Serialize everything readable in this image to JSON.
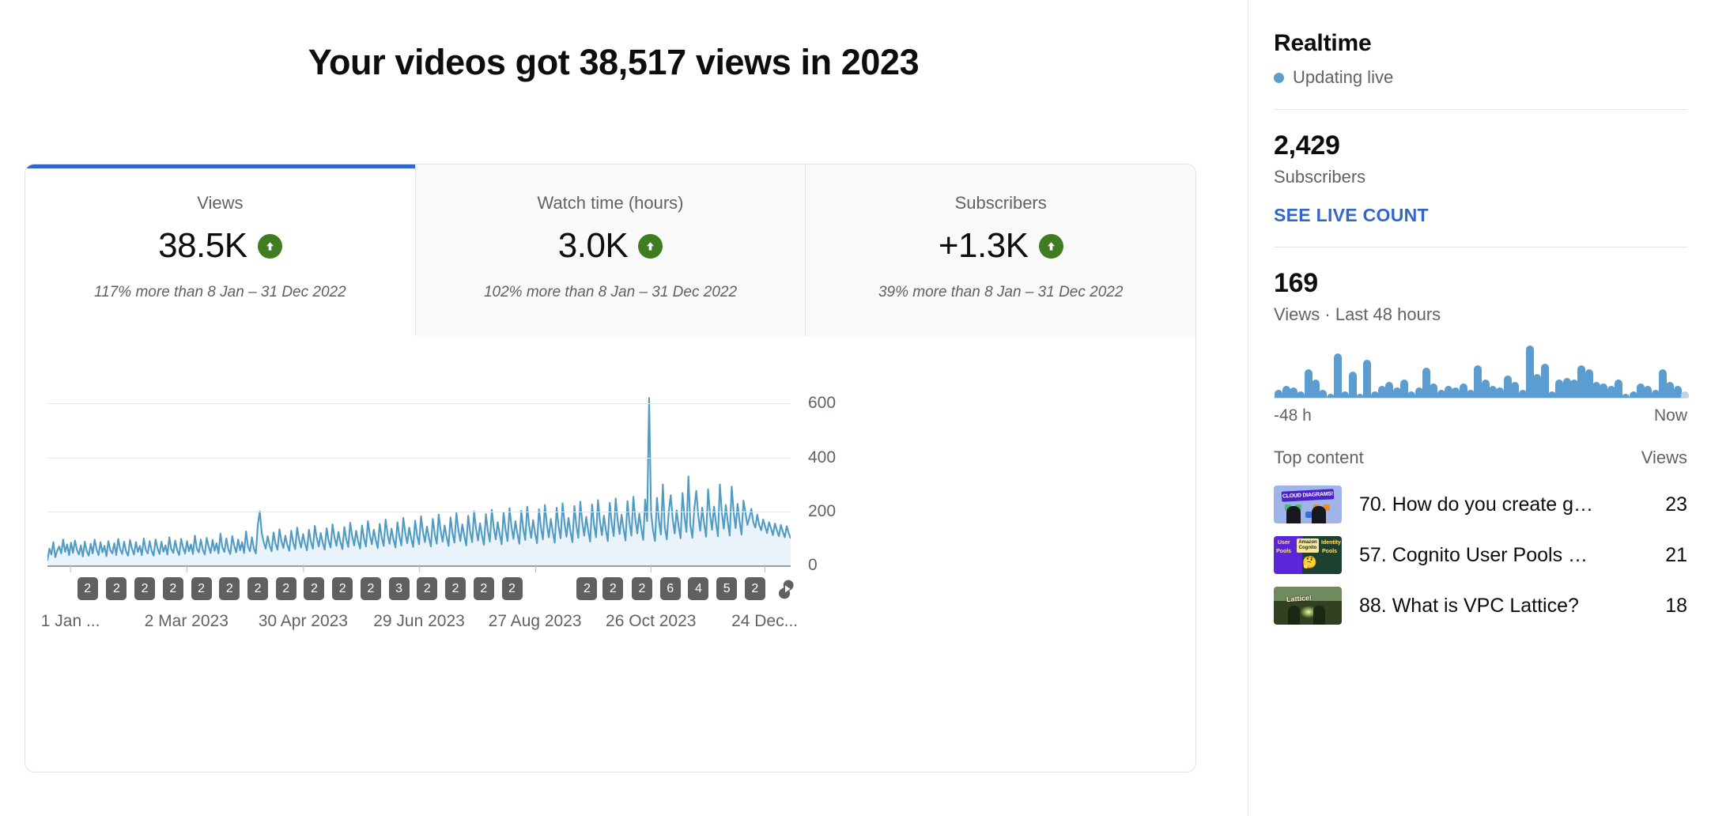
{
  "header": {
    "title": "Your videos got 38,517 views in 2023"
  },
  "metric_tabs": [
    {
      "label": "Views",
      "value": "38.5K",
      "trend": "up",
      "trend_icon": "arrow-up-circle-icon",
      "comparison": "117% more than 8 Jan – 31 Dec 2022",
      "active": true
    },
    {
      "label": "Watch time (hours)",
      "value": "3.0K",
      "trend": "up",
      "trend_icon": "arrow-up-circle-icon",
      "comparison": "102% more than 8 Jan – 31 Dec 2022",
      "active": false
    },
    {
      "label": "Subscribers",
      "value": "+1.3K",
      "trend": "up",
      "trend_icon": "arrow-up-circle-icon",
      "comparison": "39% more than 8 Jan – 31 Dec 2022",
      "active": false
    }
  ],
  "colors": {
    "accent_blue": "#3366cc",
    "trend_green": "#3f7d20",
    "line_blue": "#4f9bc4",
    "area_blue": "#eaf3f9",
    "badge_gray": "#606060",
    "live_dot": "#5b9dd0"
  },
  "chart_data": {
    "type": "area",
    "title": "",
    "xlabel": "",
    "ylabel": "",
    "ylim": [
      0,
      680
    ],
    "yticks": [
      0,
      200,
      400,
      600
    ],
    "ytick_labels": [
      "0",
      "200",
      "400",
      "600"
    ],
    "grid": true,
    "legend": "none",
    "x_tick_labels": [
      "1 Jan ...",
      "2 Mar 2023",
      "30 Apr 2023",
      "29 Jun 2023",
      "27 Aug 2023",
      "26 Oct 2023",
      "24 Dec..."
    ],
    "x_tick_positions": [
      0.031,
      0.187,
      0.344,
      0.5,
      0.656,
      0.812,
      0.965
    ],
    "series": [
      {
        "name": "Views",
        "values": [
          18,
          62,
          40,
          86,
          30,
          55,
          70,
          44,
          96,
          50,
          78,
          38,
          84,
          46,
          92,
          58,
          40,
          74,
          33,
          88,
          52,
          36,
          80,
          44,
          95,
          60,
          38,
          86,
          48,
          72,
          34,
          90,
          56,
          44,
          82,
          38,
          98,
          60,
          42,
          88,
          52,
          36,
          94,
          62,
          40,
          86,
          50,
          72,
          38,
          100,
          58,
          44,
          90,
          54,
          36,
          96,
          64,
          42,
          88,
          50,
          74,
          40,
          104,
          60,
          46,
          92,
          56,
          38,
          98,
          66,
          44,
          90,
          52,
          78,
          42,
          110,
          62,
          48,
          96,
          58,
          40,
          102,
          70,
          46,
          94,
          54,
          82,
          44,
          118,
          66,
          50,
          100,
          60,
          42,
          108,
          74,
          48,
          96,
          56,
          86,
          46,
          126,
          70,
          52,
          104,
          62,
          44,
          150,
          200,
          120,
          86,
          62,
          108,
          74,
          52,
          122,
          80,
          58,
          134,
          90,
          64,
          110,
          76,
          54,
          128,
          84,
          60,
          140,
          96,
          66,
          116,
          80,
          56,
          132,
          88,
          62,
          146,
          100,
          70,
          120,
          84,
          58,
          138,
          92,
          66,
          152,
          104,
          72,
          124,
          88,
          60,
          142,
          96,
          68,
          158,
          108,
          74,
          128,
          90,
          62,
          148,
          100,
          70,
          164,
          112,
          78,
          132,
          94,
          64,
          154,
          104,
          72,
          170,
          116,
          80,
          136,
          96,
          66,
          160,
          108,
          74,
          176,
          120,
          82,
          140,
          100,
          68,
          166,
          112,
          78,
          182,
          124,
          86,
          144,
          104,
          70,
          172,
          116,
          80,
          188,
          128,
          88,
          148,
          106,
          72,
          178,
          120,
          84,
          194,
          132,
          90,
          152,
          110,
          74,
          184,
          124,
          86,
          200,
          136,
          92,
          156,
          112,
          76,
          190,
          128,
          88,
          206,
          140,
          96,
          160,
          116,
          78,
          196,
          132,
          90,
          212,
          144,
          98,
          164,
          118,
          80,
          202,
          136,
          94,
          218,
          148,
          102,
          168,
          120,
          82,
          208,
          140,
          96,
          224,
          152,
          104,
          172,
          124,
          84,
          214,
          144,
          100,
          230,
          156,
          106,
          176,
          126,
          86,
          220,
          148,
          102,
          236,
          160,
          110,
          180,
          130,
          88,
          226,
          152,
          104,
          242,
          164,
          112,
          184,
          132,
          90,
          232,
          156,
          108,
          248,
          168,
          116,
          188,
          136,
          92,
          238,
          160,
          110,
          254,
          172,
          118,
          192,
          138,
          94,
          244,
          164,
          620,
          196,
          130,
          90,
          250,
          168,
          114,
          300,
          140,
          96,
          200,
          260,
          172,
          118,
          204,
          146,
          100,
          268,
          180,
          124,
          330,
          150,
          102,
          210,
          276,
          186,
          128,
          214,
          154,
          106,
          282,
          190,
          132,
          218,
          158,
          108,
          300,
          196,
          136,
          224,
          162,
          110,
          292,
          198,
          138,
          228,
          164,
          114,
          240,
          196,
          150,
          176,
          210,
          160,
          140,
          188,
          150,
          130,
          170,
          145,
          120,
          160,
          138,
          112,
          155,
          130,
          108,
          150,
          125,
          104,
          145,
          120,
          100
        ]
      }
    ],
    "video_count_badges": [
      {
        "label": "2",
        "pos": 0.054
      },
      {
        "label": "2",
        "pos": 0.093
      },
      {
        "label": "2",
        "pos": 0.131
      },
      {
        "label": "2",
        "pos": 0.169
      },
      {
        "label": "2",
        "pos": 0.207
      },
      {
        "label": "2",
        "pos": 0.245
      },
      {
        "label": "2",
        "pos": 0.283
      },
      {
        "label": "2",
        "pos": 0.321
      },
      {
        "label": "2",
        "pos": 0.359
      },
      {
        "label": "2",
        "pos": 0.397
      },
      {
        "label": "2",
        "pos": 0.435
      },
      {
        "label": "3",
        "pos": 0.473
      },
      {
        "label": "2",
        "pos": 0.511
      },
      {
        "label": "2",
        "pos": 0.549
      },
      {
        "label": "2",
        "pos": 0.587
      },
      {
        "label": "2",
        "pos": 0.625
      },
      {
        "label": "2",
        "pos": 0.726
      },
      {
        "label": "2",
        "pos": 0.761
      },
      {
        "label": "2",
        "pos": 0.8
      },
      {
        "label": "6",
        "pos": 0.838
      },
      {
        "label": "4",
        "pos": 0.876
      },
      {
        "label": "5",
        "pos": 0.914
      },
      {
        "label": "2",
        "pos": 0.952
      }
    ],
    "shorts_marker": {
      "icon": "shorts-icon",
      "pos": 0.995
    }
  },
  "realtime": {
    "title": "Realtime",
    "status": "Updating live",
    "status_icon": "live-dot-icon",
    "subscribers_count": "2,429",
    "subscribers_label": "Subscribers",
    "see_live_count": "SEE LIVE COUNT",
    "views_count": "169",
    "views_label": "Views · Last 48 hours",
    "sparkline": {
      "type": "bar",
      "range_start": "-48 h",
      "range_end": "Now",
      "values": [
        4,
        6,
        5,
        3,
        14,
        9,
        4,
        2,
        22,
        3,
        13,
        2,
        19,
        3,
        6,
        8,
        5,
        9,
        3,
        5,
        15,
        7,
        4,
        6,
        5,
        7,
        4,
        16,
        9,
        6,
        5,
        11,
        8,
        4,
        26,
        12,
        17,
        3,
        9,
        10,
        9,
        16,
        14,
        8,
        7,
        6,
        9,
        2,
        3,
        7,
        6,
        4,
        14,
        8,
        6,
        3
      ]
    },
    "top_content": {
      "col_title": "Top content",
      "col_views": "Views",
      "rows": [
        {
          "title": "70. How do you create g…",
          "views": "23",
          "thumb": "cloud-diagrams-thumbnail"
        },
        {
          "title": "57. Cognito User Pools …",
          "views": "21",
          "thumb": "cognito-pools-thumbnail"
        },
        {
          "title": "88. What is VPC Lattice?",
          "views": "18",
          "thumb": "vpc-lattice-thumbnail"
        }
      ]
    }
  }
}
